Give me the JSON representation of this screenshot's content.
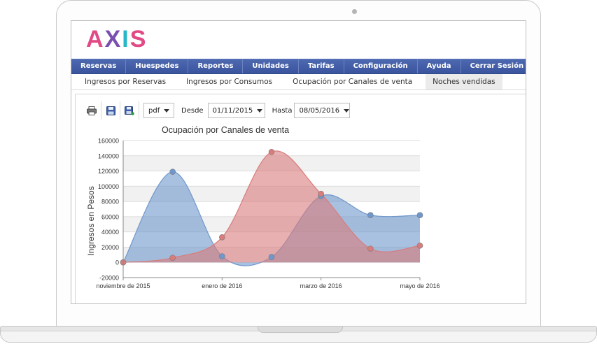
{
  "app": {
    "logo_letters": [
      {
        "char": "A",
        "color": "#e24a86"
      },
      {
        "char": "X",
        "color": "#7a4fb0"
      },
      {
        "char": "I",
        "color": "#28b7c8"
      },
      {
        "char": "S",
        "color": "#e24a86"
      }
    ]
  },
  "menu": {
    "items": [
      "Reservas",
      "Huespedes",
      "Reportes",
      "Unidades",
      "Tarifas",
      "Configuración",
      "Ayuda",
      "Cerrar Sesión"
    ]
  },
  "tabs": {
    "items": [
      "Ingresos por Reservas",
      "Ingresos por Consumos",
      "Ocupación por Canales de venta",
      "Noches vendidas"
    ],
    "active_index": 3
  },
  "toolbar": {
    "print_icon": "printer-icon",
    "save_icon": "floppy-disk-icon",
    "save_as_icon": "floppy-save-as-icon",
    "format": "pdf",
    "from_label": "Desde",
    "from_value": "01/11/2015",
    "to_label": "Hasta",
    "to_value": "08/05/2016"
  },
  "chart_data": {
    "type": "area",
    "title": "Ocupación por Canales de venta",
    "xlabel": "",
    "ylabel": "Ingresos en Pesos",
    "ylim": [
      -20000,
      160000
    ],
    "yticks": [
      -20000,
      0,
      20000,
      40000,
      60000,
      80000,
      100000,
      120000,
      140000,
      160000
    ],
    "x_labels": [
      "noviembre de 2015",
      "enero de 2016",
      "marzo de 2016",
      "mayo de 2016"
    ],
    "grid": true,
    "series": [
      {
        "color": "#6f97cc",
        "x": [
          0,
          1,
          2,
          3,
          4,
          5,
          6
        ],
        "values": [
          0,
          119000,
          8000,
          7000,
          87000,
          62000,
          62000
        ]
      },
      {
        "color": "#d87c7c",
        "x": [
          0,
          1,
          2,
          3,
          4,
          5,
          6
        ],
        "values": [
          0,
          6000,
          33000,
          145000,
          90000,
          18000,
          22000
        ]
      }
    ]
  }
}
